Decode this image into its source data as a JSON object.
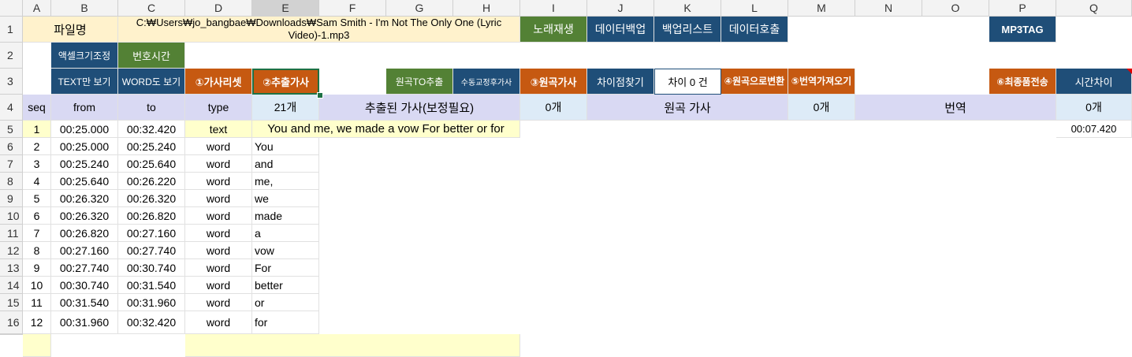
{
  "columns": [
    "A",
    "B",
    "C",
    "D",
    "E",
    "F",
    "G",
    "H",
    "I",
    "J",
    "K",
    "L",
    "M",
    "N",
    "O",
    "P",
    "Q"
  ],
  "rows": [
    "1",
    "2",
    "3",
    "4",
    "5",
    "6",
    "7",
    "8",
    "9",
    "10",
    "11",
    "12",
    "13",
    "14",
    "15",
    "16"
  ],
  "row1": {
    "filename_label": "파일명",
    "filepath": "C:₩Users₩jo_bangbae₩Downloads₩Sam Smith - I'm Not The Only One (Lyric Video)-1.mp3",
    "play_song": "노래재생",
    "data_backup": "데이터백업",
    "backup_list": "백업리스트",
    "data_load": "데이터호출",
    "mp3tag": "MP3TAG"
  },
  "row2": {
    "cell_size": "액셀크기조정",
    "number_time": "번호시간"
  },
  "row3": {
    "text_only": "TEXT만 보기",
    "word_view": "WORD도 보기",
    "lyrics_set": "①가사리셋",
    "extract_lyrics": "②추출가사",
    "original_to_extract": "원곡TO추출",
    "manual_fix": "수동교정후가사",
    "original_lyrics": "③원곡가사",
    "find_diff": "차이점찾기",
    "diff_count": "차이 0 건",
    "to_original": "④원곡으로변환",
    "get_translation": "⑤번역가져오기",
    "final_transfer": "⑥최종품전송",
    "time_diff": "시간차이"
  },
  "row4": {
    "seq": "seq",
    "from": "from",
    "to": "to",
    "type": "type",
    "count_extracted": "21개",
    "extracted_header": "추출된 가사(보정필요)",
    "count_original": "0개",
    "original_header": "원곡 가사",
    "count_translation": "0개",
    "translation_header": "번역",
    "count_time": "0개"
  },
  "data_rows": [
    {
      "seq": "1",
      "from": "00:25.000",
      "to": "00:32.420",
      "type": "text",
      "lyric": "You and me, we made a vow For better or for",
      "diff": "00:07.420"
    },
    {
      "seq": "2",
      "from": "00:25.000",
      "to": "00:25.240",
      "type": "word",
      "lyric": "You",
      "diff": ""
    },
    {
      "seq": "3",
      "from": "00:25.240",
      "to": "00:25.640",
      "type": "word",
      "lyric": "and",
      "diff": ""
    },
    {
      "seq": "4",
      "from": "00:25.640",
      "to": "00:26.220",
      "type": "word",
      "lyric": "me,",
      "diff": ""
    },
    {
      "seq": "5",
      "from": "00:26.320",
      "to": "00:26.320",
      "type": "word",
      "lyric": "we",
      "diff": ""
    },
    {
      "seq": "6",
      "from": "00:26.320",
      "to": "00:26.820",
      "type": "word",
      "lyric": "made",
      "diff": ""
    },
    {
      "seq": "7",
      "from": "00:26.820",
      "to": "00:27.160",
      "type": "word",
      "lyric": "a",
      "diff": ""
    },
    {
      "seq": "8",
      "from": "00:27.160",
      "to": "00:27.740",
      "type": "word",
      "lyric": "vow",
      "diff": ""
    },
    {
      "seq": "9",
      "from": "00:27.740",
      "to": "00:30.740",
      "type": "word",
      "lyric": "For",
      "diff": ""
    },
    {
      "seq": "10",
      "from": "00:30.740",
      "to": "00:31.540",
      "type": "word",
      "lyric": "better",
      "diff": ""
    },
    {
      "seq": "11",
      "from": "00:31.540",
      "to": "00:31.960",
      "type": "word",
      "lyric": "or",
      "diff": ""
    },
    {
      "seq": "12",
      "from": "00:31.960",
      "to": "00:32.420",
      "type": "word",
      "lyric": "for",
      "diff": ""
    }
  ],
  "colors": {
    "yellow": "#fff2cc",
    "light_yellow": "#ffffcc",
    "blue_dark": "#1f4e78",
    "green": "#538135",
    "orange": "#c65911",
    "lavender": "#d9d9f3",
    "light_blue": "#ddebf7"
  }
}
